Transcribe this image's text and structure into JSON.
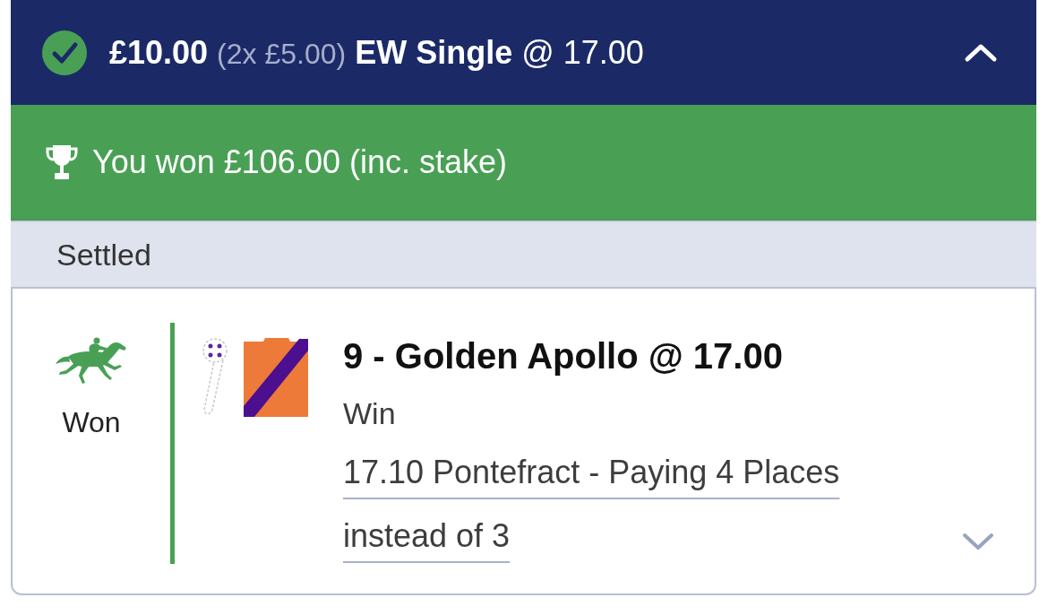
{
  "bet": {
    "stake": "£10.00",
    "stake_breakdown": "(2x £5.00)",
    "bet_type": "EW Single",
    "odds": "@ 17.00",
    "expanded": true
  },
  "result_banner": {
    "text": "You won £106.00 (inc. stake)"
  },
  "status_bar": {
    "label": "Settled"
  },
  "selection": {
    "result": "Won",
    "title": "9 - Golden Apollo @ 17.00",
    "market": "Win",
    "event_link": "17.10 Pontefract - Paying 4 Places instead of 3",
    "expanded": false
  }
}
